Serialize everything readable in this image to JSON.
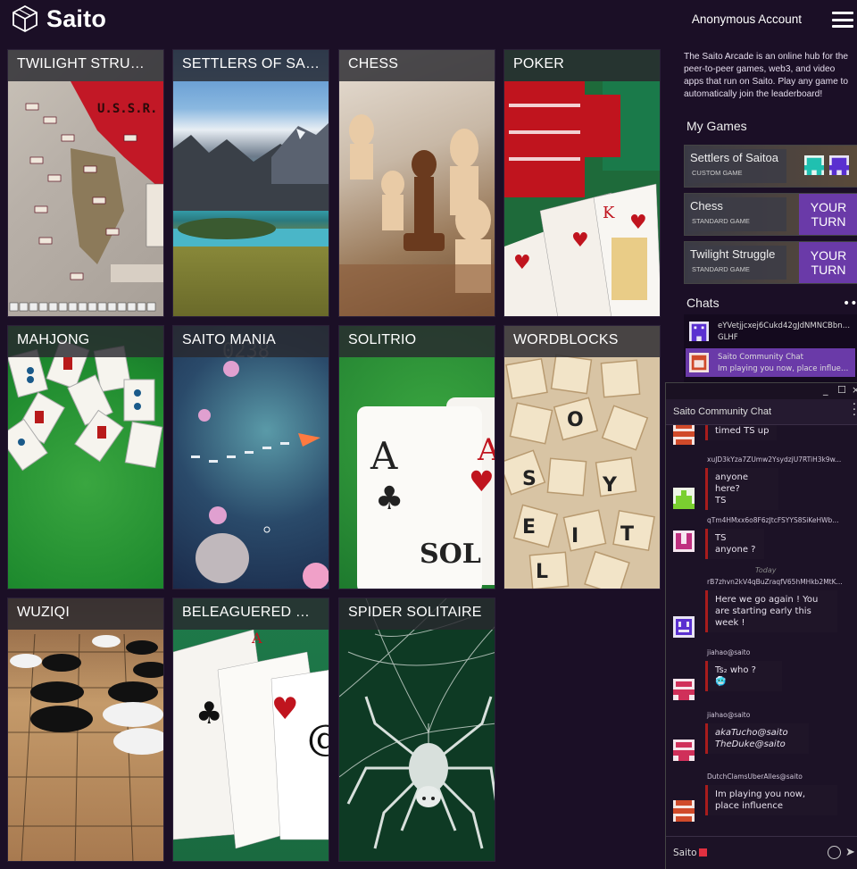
{
  "header": {
    "logo_text": "Saito",
    "account_label": "Anonymous Account"
  },
  "games": [
    {
      "title": "TWILIGHT STRUGG..."
    },
    {
      "title": "SETTLERS OF SAITOA"
    },
    {
      "title": "CHESS"
    },
    {
      "title": "POKER"
    },
    {
      "title": "MAHJONG"
    },
    {
      "title": "SAITO MANIA"
    },
    {
      "title": "SOLITRIO"
    },
    {
      "title": "WORDBLOCKS"
    },
    {
      "title": "WUZIQI"
    },
    {
      "title": "BELEAGUERED CAS..."
    },
    {
      "title": "SPIDER SOLITAIRE"
    }
  ],
  "sidebar": {
    "intro": "The Saito Arcade is an online hub for the peer-to-peer games, web3, and video apps that run on Saito. Play any game to automatically join the leaderboard!",
    "my_games_title": "My Games",
    "my_games": [
      {
        "name": "Settlers of Saitoa",
        "type": "CUSTOM GAME",
        "status": ""
      },
      {
        "name": "Chess",
        "type": "STANDARD GAME",
        "status": "YOUR TURN"
      },
      {
        "name": "Twilight Struggle",
        "type": "STANDARD GAME",
        "status": "YOUR TURN"
      }
    ],
    "chats_title": "Chats",
    "chats": [
      {
        "name": "eYVetjjcxej6Cukd42gJdNMNCBbn8Y...",
        "message": "GLHF"
      },
      {
        "name": "Saito Community Chat",
        "message": "Im playing you now, place influen..."
      }
    ]
  },
  "chat_window": {
    "title": "Saito Community Chat",
    "messages": [
      {
        "sender": "",
        "lines": [
          "timed TS up"
        ]
      },
      {
        "sender": "xuJD3kYza7ZUmw2YsydzjU7RTiH3k9w...",
        "lines": [
          "anyone here?",
          "TS"
        ]
      },
      {
        "sender": "qTm4HMxx6o8F6zJtcFSYYS8SiKeHWb...",
        "lines": [
          "TS anyone ?"
        ]
      },
      {
        "sender": "rB7zhvn2kV4qBuZraqfV65hMHkb2MtK...",
        "lines": [
          "Here we go again ! You",
          "are starting early this",
          "week !"
        ]
      },
      {
        "sender": "jiahao@saito",
        "lines": [
          "Ts₂  who ?",
          "🥶"
        ]
      },
      {
        "sender": "jiahao@saito",
        "lines": [
          "akaTucho@saito",
          "TheDuke@saito"
        ]
      },
      {
        "sender": "DutchClamsUberAlles@saito",
        "lines": [
          "Im playing you now,",
          "place influence"
        ]
      }
    ],
    "day_separator": "Today",
    "input_value": "Saito"
  },
  "colors": {
    "background": "#1b0f26",
    "accent_purple": "#6a3aa8",
    "bubble_border": "#a81c1c"
  }
}
